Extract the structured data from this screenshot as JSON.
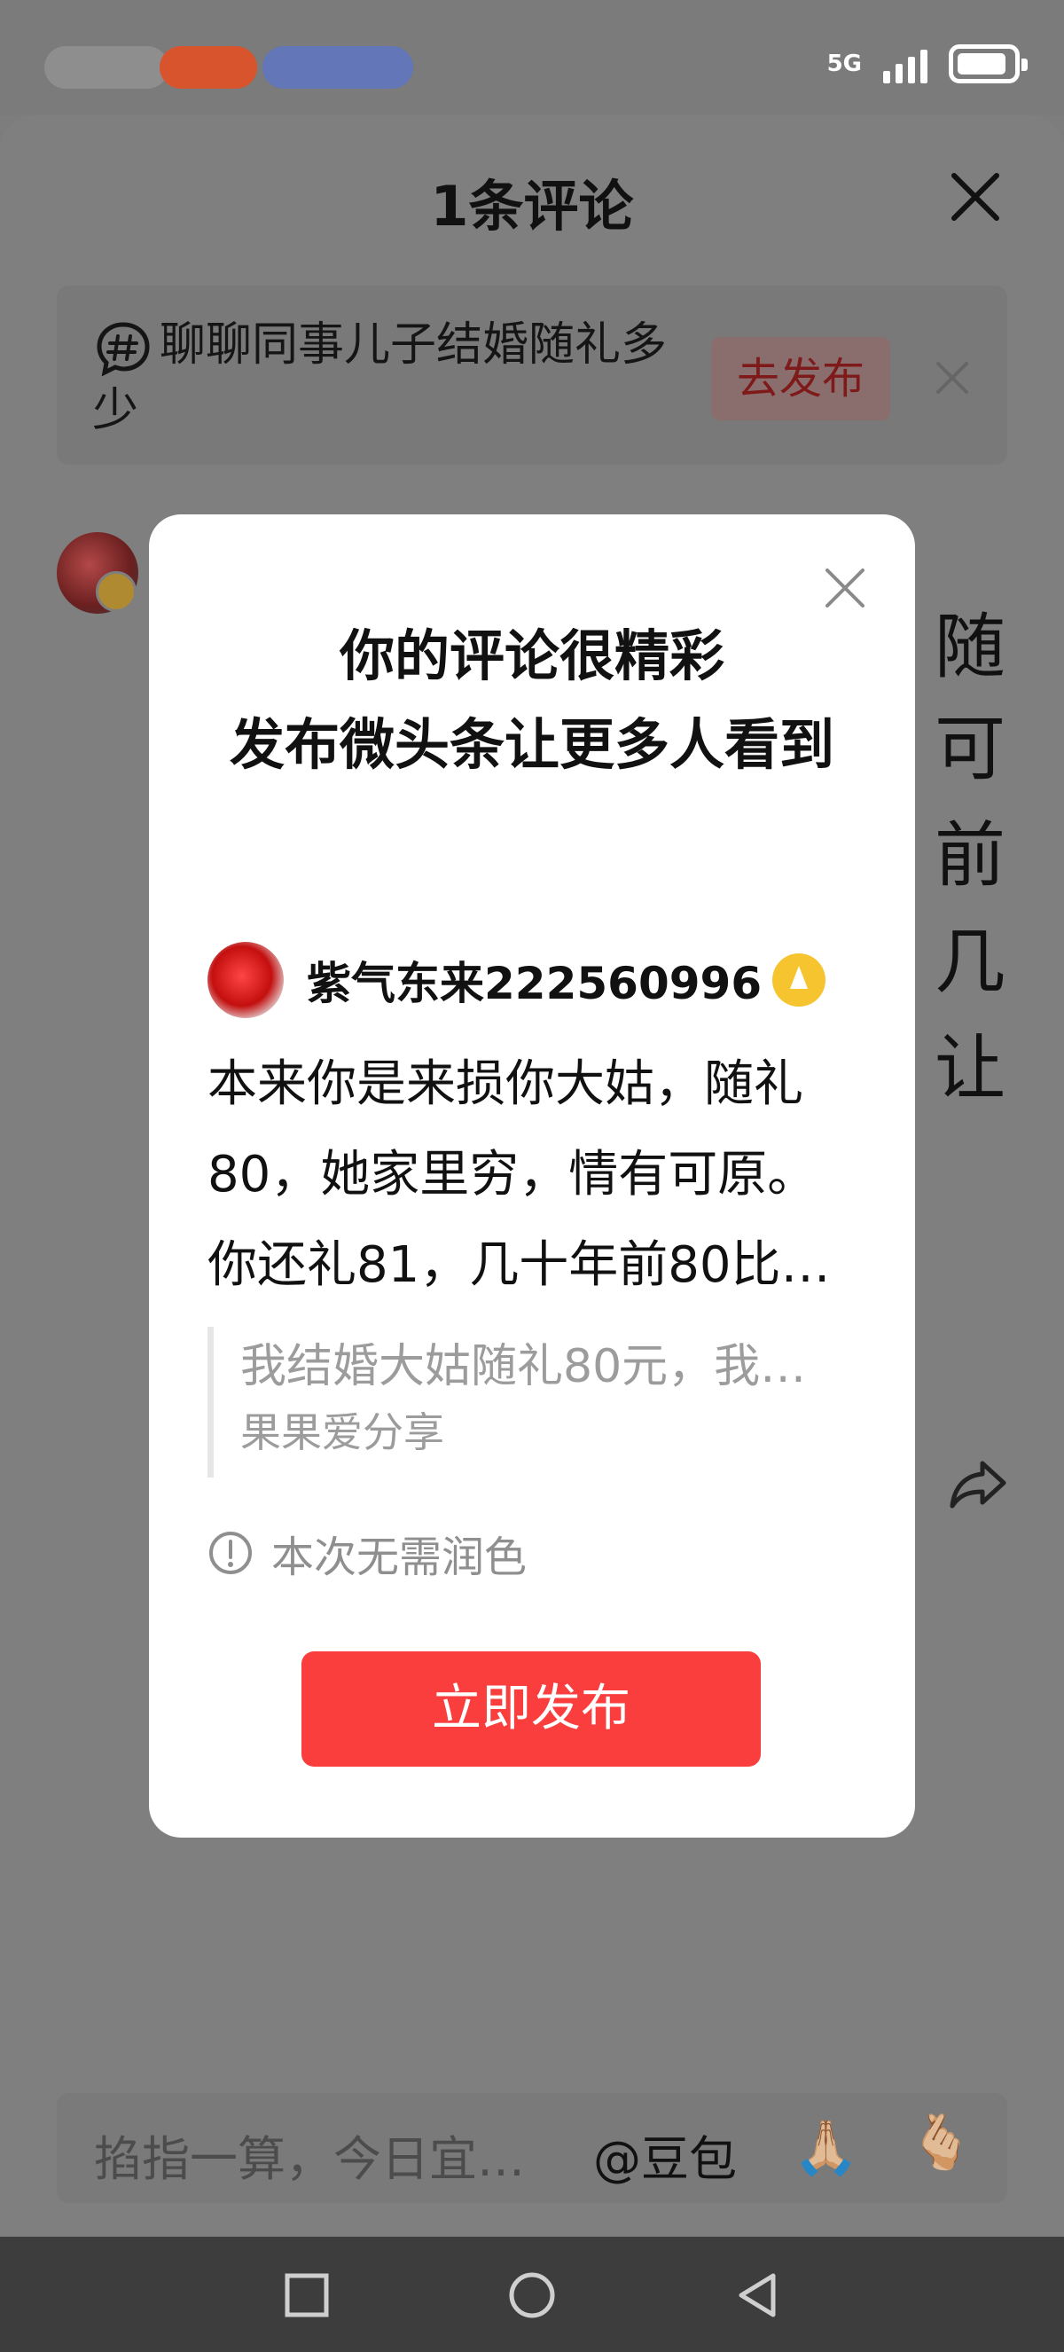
{
  "status_bar": {
    "network": "5G"
  },
  "comment_sheet": {
    "title": "1条评论",
    "topic": {
      "text": "聊聊同事儿子结婚随礼多少",
      "publish_label": "去发布"
    },
    "bg_comment_fragments": [
      "随",
      "可",
      "前",
      "几",
      "让"
    ]
  },
  "modal": {
    "headline_line1": "你的评论很精彩",
    "headline_line2": "发布微头条让更多人看到",
    "author": "紫气东来222560996",
    "comment": "本来你是来损你大姑，随礼80，她家里穷，情有可原。你还礼81，几十年前80比…",
    "quote_text": "我结婚大姑随礼80元，我…",
    "quote_author": "果果爱分享",
    "notice": "本次无需润色",
    "publish_button": "立即发布"
  },
  "input_bar": {
    "placeholder": "掐指一算，今日宜…",
    "mention": "@豆包",
    "emoji_1": "🙏🏼",
    "emoji_2": "🫰🏼"
  },
  "colors": {
    "accent_red": "#fa3d3d",
    "overlay": "#7f7f7f",
    "badge_gold": "#f5c42e"
  }
}
